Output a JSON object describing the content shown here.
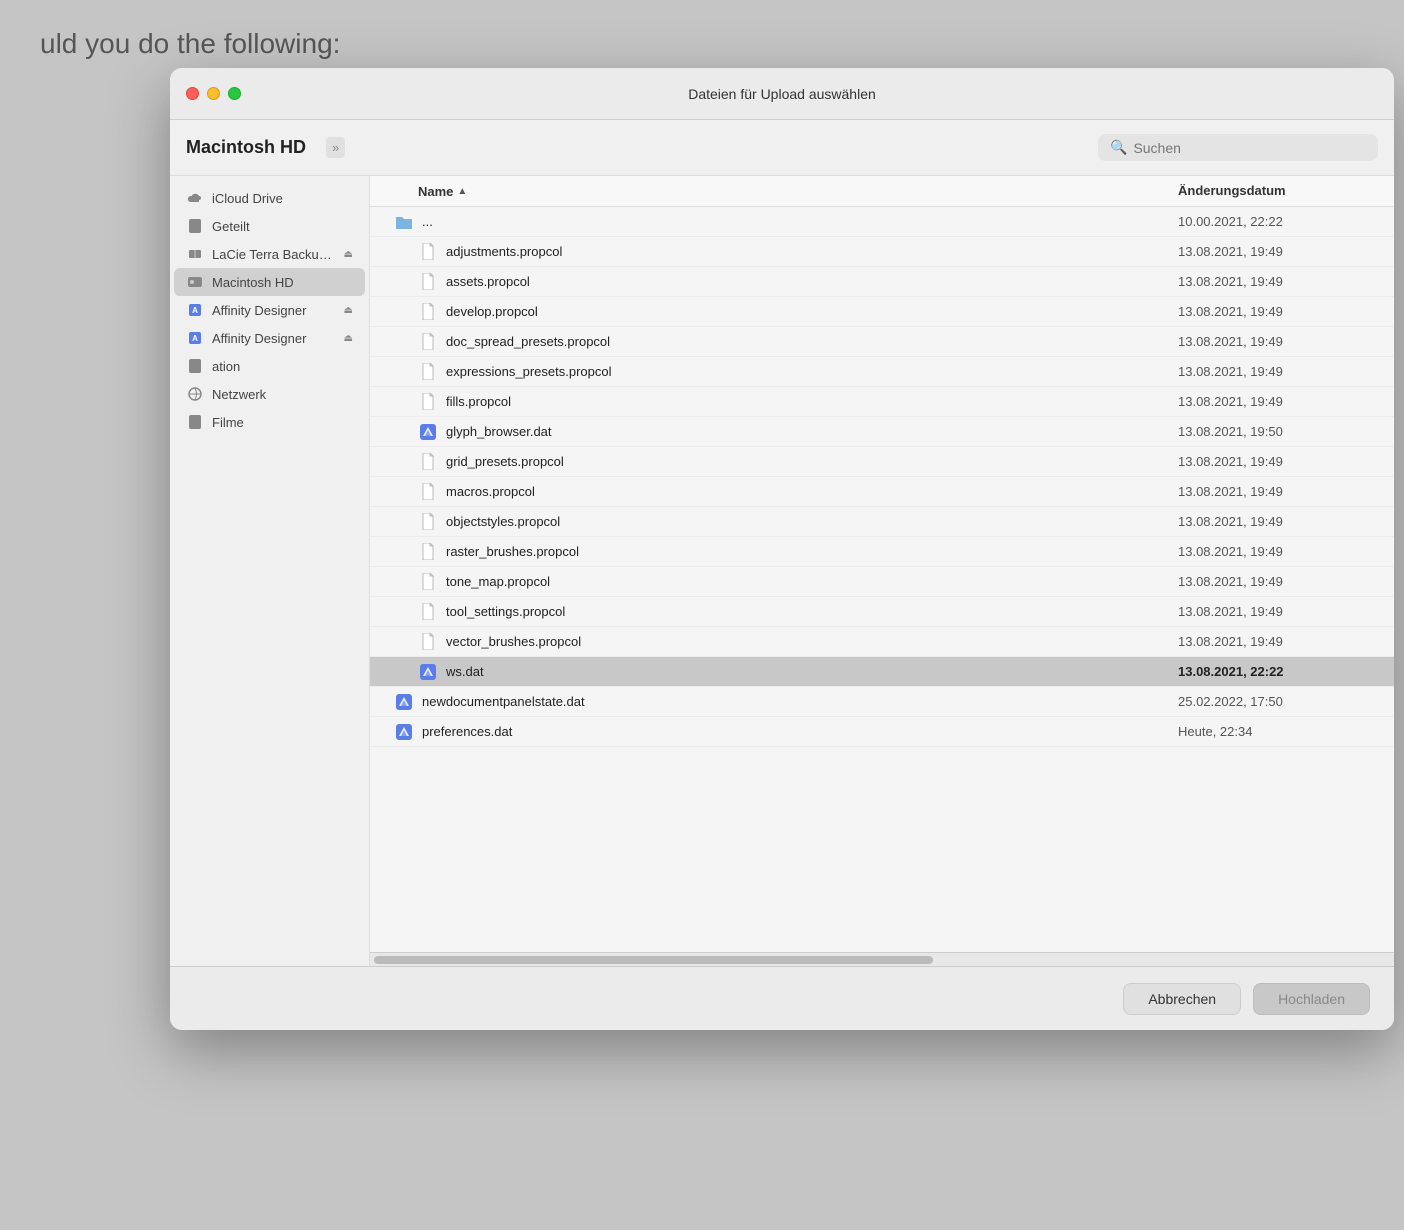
{
  "background": {
    "text": "uld you do the following:"
  },
  "dialog": {
    "title": "Dateien für Upload auswählen",
    "location": "Macintosh HD",
    "search_placeholder": "Suchen",
    "columns": {
      "name": "Name",
      "date": "Änderungsdatum"
    },
    "cancel_label": "Abbrechen",
    "upload_label": "Hochladen"
  },
  "sidebar_items": [
    {
      "id": "icloud-drive",
      "label": "iCloud Drive",
      "icon": "cloud",
      "eject": false
    },
    {
      "id": "geteilt",
      "label": "Geteilt",
      "icon": "share",
      "eject": false
    },
    {
      "id": "lacie",
      "label": "LaCie Terra Backup Store",
      "icon": "drive",
      "eject": true
    },
    {
      "id": "macintosh-hd",
      "label": "Macintosh HD",
      "icon": "hd",
      "eject": false,
      "active": true
    },
    {
      "id": "affinity-designer-1",
      "label": "Affinity Designer",
      "icon": "affinity",
      "eject": true
    },
    {
      "id": "affinity-designer-2",
      "label": "Affinity Designer",
      "icon": "affinity",
      "eject": true
    },
    {
      "id": "ation",
      "label": "ation",
      "icon": "folder",
      "eject": false
    },
    {
      "id": "netzwerk",
      "label": "Netzwerk",
      "icon": "network",
      "eject": false
    },
    {
      "id": "filme",
      "label": "Filme",
      "icon": "folder",
      "eject": false
    }
  ],
  "files": [
    {
      "name": "...",
      "date": "10.00.2021, 22:22",
      "type": "folder",
      "indent": false
    },
    {
      "name": "adjustments.propcol",
      "date": "13.08.2021, 19:49",
      "type": "file",
      "indent": true
    },
    {
      "name": "assets.propcol",
      "date": "13.08.2021, 19:49",
      "type": "file",
      "indent": true
    },
    {
      "name": "develop.propcol",
      "date": "13.08.2021, 19:49",
      "type": "file",
      "indent": true
    },
    {
      "name": "doc_spread_presets.propcol",
      "date": "13.08.2021, 19:49",
      "type": "file",
      "indent": true
    },
    {
      "name": "expressions_presets.propcol",
      "date": "13.08.2021, 19:49",
      "type": "file",
      "indent": true
    },
    {
      "name": "fills.propcol",
      "date": "13.08.2021, 19:49",
      "type": "file",
      "indent": true
    },
    {
      "name": "glyph_browser.dat",
      "date": "13.08.2021, 19:50",
      "type": "affinity",
      "indent": true
    },
    {
      "name": "grid_presets.propcol",
      "date": "13.08.2021, 19:49",
      "type": "file",
      "indent": true
    },
    {
      "name": "macros.propcol",
      "date": "13.08.2021, 19:49",
      "type": "file",
      "indent": true
    },
    {
      "name": "objectstyles.propcol",
      "date": "13.08.2021, 19:49",
      "type": "file",
      "indent": true
    },
    {
      "name": "raster_brushes.propcol",
      "date": "13.08.2021, 19:49",
      "type": "file",
      "indent": true
    },
    {
      "name": "tone_map.propcol",
      "date": "13.08.2021, 19:49",
      "type": "file",
      "indent": true
    },
    {
      "name": "tool_settings.propcol",
      "date": "13.08.2021, 19:49",
      "type": "file",
      "indent": true
    },
    {
      "name": "vector_brushes.propcol",
      "date": "13.08.2021, 19:49",
      "type": "file",
      "indent": true
    },
    {
      "name": "ws.dat",
      "date": "13.08.2021, 22:22",
      "type": "affinity",
      "indent": true,
      "selected": true
    },
    {
      "name": "newdocumentpanelstate.dat",
      "date": "25.02.2022, 17:50",
      "type": "affinity",
      "indent": false
    },
    {
      "name": "preferences.dat",
      "date": "Heute, 22:34",
      "type": "affinity",
      "indent": false
    }
  ]
}
